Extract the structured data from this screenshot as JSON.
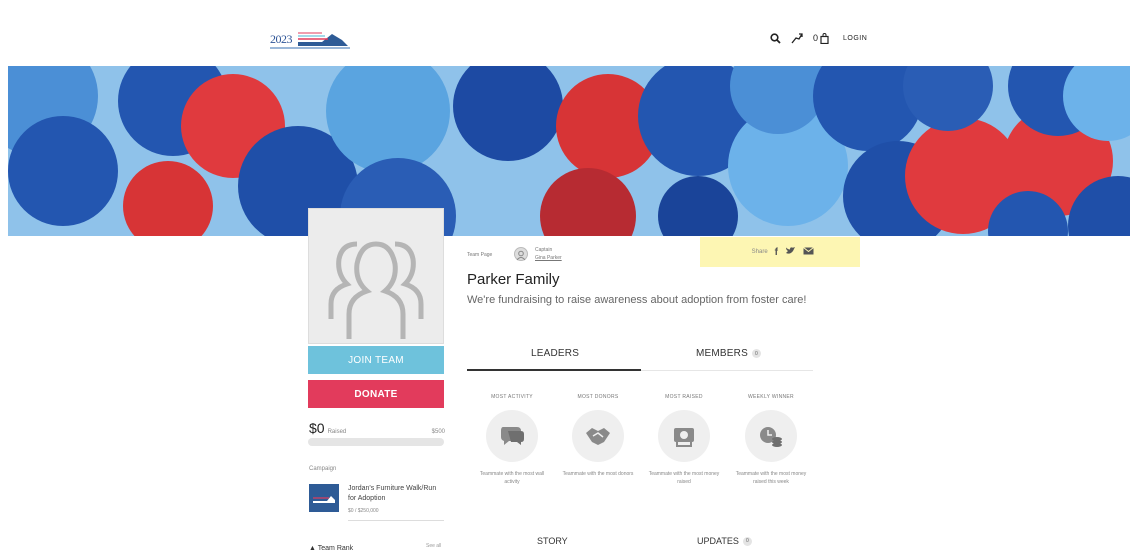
{
  "header": {
    "logo_year": "2023",
    "cart_count": "0",
    "login_label": "LOGIN"
  },
  "team": {
    "page_label": "Team Page",
    "captain_role": "Captain",
    "captain_name": "Gina Parker",
    "name": "Parker Family",
    "description": "We're fundraising to raise awareness about adoption from foster care!"
  },
  "share": {
    "label": "Share"
  },
  "sidebar": {
    "join_label": "JOIN TEAM",
    "donate_label": "DONATE",
    "raised_amount": "$0",
    "raised_label": "Raised",
    "goal": "$500",
    "progress_fraction": 0.0,
    "campaign_label": "Campaign",
    "campaign_name": "Jordan's Furniture Walk/Run for Adoption",
    "campaign_amount": "$0 / $250,000",
    "team_rank_label": "Team Rank",
    "see_all": "See all"
  },
  "tabs": {
    "leaders": "LEADERS",
    "members": "MEMBERS",
    "members_count": "0",
    "story": "STORY",
    "updates": "UPDATES",
    "updates_count": "0"
  },
  "leaderboard": [
    {
      "title": "MOST ACTIVITY",
      "icon": "chat-icon",
      "desc": "Teammate with the most wall activity"
    },
    {
      "title": "MOST DONORS",
      "icon": "handshake-icon",
      "desc": "Teammate with the most donors"
    },
    {
      "title": "MOST RAISED",
      "icon": "money-icon",
      "desc": "Teammate with the most money raised"
    },
    {
      "title": "WEEKLY WINNER",
      "icon": "clock-coins-icon",
      "desc": "Teammate with the most money raised this week"
    }
  ],
  "colors": {
    "join": "#6ec2dc",
    "donate": "#e23b5c",
    "share_bg": "#fdf6b3",
    "brand_blue": "#2e5b96"
  }
}
